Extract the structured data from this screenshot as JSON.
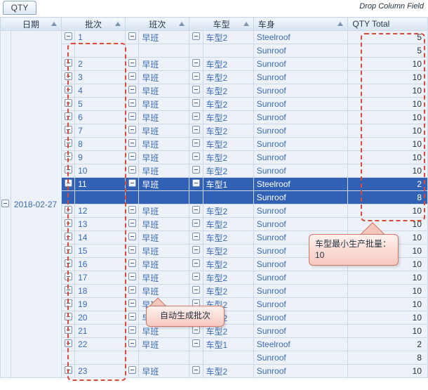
{
  "cornerTab": "QTY",
  "dropHint": "Drop Column Field",
  "dropHintColor": "#3a6ab5",
  "headers": {
    "date": "日期",
    "batch": "批次",
    "shift": "班次",
    "model": "车型",
    "body": "车身",
    "qty": "QTY Total"
  },
  "date": "2018-02-27",
  "rows": [
    {
      "firstDate": true,
      "batch": "1",
      "firstBatch": true,
      "shift": "早班",
      "model": "车型2",
      "body": "Steelroof",
      "qty": 5,
      "selected": false
    },
    {
      "spanBatch": true,
      "spanShift": true,
      "spanModel": true,
      "body": "Sunroof",
      "qty": 5
    },
    {
      "batch": "2",
      "shift": "早班",
      "model": "车型2",
      "body": "Sunroof",
      "qty": 10
    },
    {
      "batch": "3",
      "shift": "早班",
      "model": "车型2",
      "body": "Sunroof",
      "qty": 10
    },
    {
      "batch": "4",
      "shift": "早班",
      "model": "车型2",
      "body": "Sunroof",
      "qty": 10
    },
    {
      "batch": "5",
      "shift": "早班",
      "model": "车型2",
      "body": "Sunroof",
      "qty": 10
    },
    {
      "batch": "6",
      "shift": "早班",
      "model": "车型2",
      "body": "Sunroof",
      "qty": 10
    },
    {
      "batch": "7",
      "shift": "早班",
      "model": "车型2",
      "body": "Sunroof",
      "qty": 10
    },
    {
      "batch": "8",
      "shift": "早班",
      "model": "车型2",
      "body": "Sunroof",
      "qty": 10
    },
    {
      "batch": "9",
      "shift": "早班",
      "model": "车型2",
      "body": "Sunroof",
      "qty": 10
    },
    {
      "batch": "10",
      "shift": "早班",
      "model": "车型2",
      "body": "Sunroof",
      "qty": 10
    },
    {
      "batch": "11",
      "shift": "早班",
      "model": "车型1",
      "body": "Steelroof",
      "qty": 2,
      "selected": true
    },
    {
      "spanBatch": true,
      "spanShift": true,
      "spanModel": true,
      "body": "Sunroof",
      "qty": 8,
      "selected": true
    },
    {
      "batch": "12",
      "shift": "早班",
      "model": "车型2",
      "body": "Sunroof",
      "qty": 10
    },
    {
      "batch": "13",
      "shift": "早班",
      "model": "车型2",
      "body": "Sunroof",
      "qty": 10
    },
    {
      "batch": "14",
      "shift": "早班",
      "model": "车型2",
      "body": "Sunroof",
      "qty": 10
    },
    {
      "batch": "15",
      "shift": "早班",
      "model": "车型2",
      "body": "Sunroof",
      "qty": 10
    },
    {
      "batch": "16",
      "shift": "早班",
      "model": "车型2",
      "body": "Sunroof",
      "qty": 10
    },
    {
      "batch": "17",
      "shift": "早班",
      "model": "车型2",
      "body": "Sunroof",
      "qty": 10
    },
    {
      "batch": "18",
      "shift": "早班",
      "model": "车型2",
      "body": "Sunroof",
      "qty": 10
    },
    {
      "batch": "19",
      "shift": "早班",
      "model": "车型2",
      "body": "Sunroof",
      "qty": 10
    },
    {
      "batch": "20",
      "shift": "早班",
      "model": "车型2",
      "body": "Sunroof",
      "qty": 10
    },
    {
      "batch": "21",
      "shift": "早班",
      "model": "车型2",
      "body": "Sunroof",
      "qty": 10
    },
    {
      "batch": "22",
      "shift": "早班",
      "model": "车型1",
      "body": "Steelroof",
      "qty": 2
    },
    {
      "spanBatch": true,
      "spanShift": true,
      "spanModel": true,
      "body": "Sunroof",
      "qty": 8
    },
    {
      "batch": "23",
      "shift": "早班",
      "model": "车型2",
      "body": "Sunroof",
      "qty": 10
    }
  ],
  "callouts": {
    "auto": "自动生成批次",
    "min": "车型最小生产批量：10"
  }
}
